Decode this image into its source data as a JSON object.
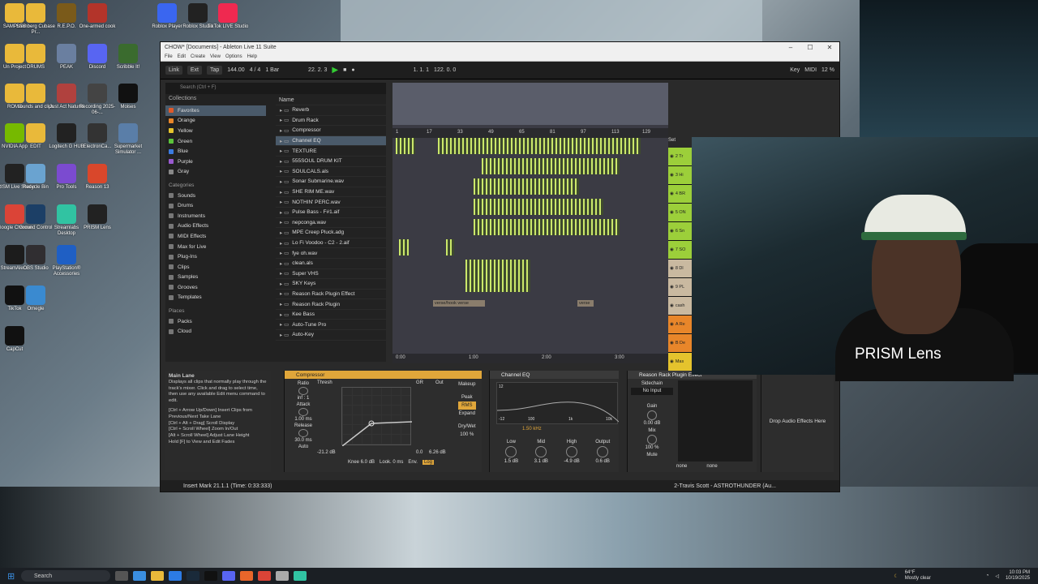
{
  "desktop": {
    "icons_left": [
      {
        "label": "SAMPLES",
        "icon": "folder-icon",
        "color": "#e9b93a"
      },
      {
        "label": "Steinberg Cubase Pr...",
        "icon": "folder-icon",
        "color": "#e9b93a"
      },
      {
        "label": "R.E.P.O.",
        "icon": "game-icon",
        "color": "#7a5a1a"
      },
      {
        "label": "One-armed cook",
        "icon": "game-icon",
        "color": "#b3342a"
      },
      {
        "label": "Un Project",
        "icon": "folder-icon",
        "color": "#e9b93a"
      },
      {
        "label": "DRUMS",
        "icon": "folder-icon",
        "color": "#e9b93a"
      },
      {
        "label": "PEAK",
        "icon": "game-icon",
        "color": "#6a7fa0"
      },
      {
        "label": "Discord",
        "icon": "discord-icon",
        "color": "#5865f2"
      },
      {
        "label": "Scribble It!",
        "icon": "game-icon",
        "color": "#3a6b2e"
      },
      {
        "label": "ROMS",
        "icon": "folder-icon",
        "color": "#e9b93a"
      },
      {
        "label": "sounds and clips",
        "icon": "folder-icon",
        "color": "#e9b93a"
      },
      {
        "label": "Just Act Natural",
        "icon": "game-icon",
        "color": "#b0413e"
      },
      {
        "label": "Recording 2025-06-...",
        "icon": "audio-file-icon",
        "color": "#444"
      },
      {
        "label": "Moises",
        "icon": "app-icon",
        "color": "#111"
      },
      {
        "label": "NVIDIA App",
        "icon": "nvidia-icon",
        "color": "#76b900"
      },
      {
        "label": "EDIT",
        "icon": "folder-icon",
        "color": "#e9b93a"
      },
      {
        "label": "Logitech G HUB",
        "icon": "logitech-icon",
        "color": "#222"
      },
      {
        "label": "ElectronCa...",
        "icon": "app-icon",
        "color": "#333"
      },
      {
        "label": "Supermarket Simulator ...",
        "icon": "game-icon",
        "color": "#5a7ea8"
      },
      {
        "label": "PRISM Live Studio",
        "icon": "prism-icon",
        "color": "#222"
      },
      {
        "label": "Recycle Bin",
        "icon": "recycle-bin-icon",
        "color": "#6aa3d0"
      },
      {
        "label": "Pro Tools",
        "icon": "protools-icon",
        "color": "#7b4bd0"
      },
      {
        "label": "Reason 13",
        "icon": "reason-icon",
        "color": "#d9472b"
      },
      {
        "label": "Google Chrome",
        "icon": "chrome-icon",
        "color": "#db4437"
      },
      {
        "label": "Ground Control",
        "icon": "app-icon",
        "color": "#1c3f66"
      },
      {
        "label": "Streamlabs Desktop",
        "icon": "streamlabs-icon",
        "color": "#31c3a2"
      },
      {
        "label": "PRISM Lens",
        "icon": "prism-icon",
        "color": "#222"
      },
      {
        "label": "StreamAler...",
        "icon": "app-icon",
        "color": "#1c1c1c"
      },
      {
        "label": "OBS Studio",
        "icon": "obs-icon",
        "color": "#302e31"
      },
      {
        "label": "PlayStation® Accessories",
        "icon": "playstation-icon",
        "color": "#1f5fc4"
      },
      {
        "label": "TikTok",
        "icon": "tiktok-icon",
        "color": "#111"
      },
      {
        "label": "Omegle",
        "icon": "app-icon",
        "color": "#3a8ad0"
      },
      {
        "label": "CapCut",
        "icon": "capcut-icon",
        "color": "#111"
      }
    ],
    "icons_top": [
      {
        "label": "Roblox Player",
        "icon": "roblox-icon",
        "color": "#3a66f0"
      },
      {
        "label": "Roblox Studio",
        "icon": "roblox-icon",
        "color": "#222"
      },
      {
        "label": "TikTok LIVE Studio",
        "icon": "tiktok-icon",
        "color": "#ef2950"
      }
    ]
  },
  "window": {
    "title": "CHOW* [Documents] - Ableton Live 11 Suite",
    "menu": [
      "File",
      "Edit",
      "Create",
      "View",
      "Options",
      "Help"
    ],
    "controls": [
      "–",
      "☐",
      "✕"
    ]
  },
  "transport": {
    "link": "Link",
    "ext": "Ext",
    "tap": "Tap",
    "tempo": "144.00",
    "signature": "4 / 4",
    "quantize": "1 Bar",
    "position": "22.  2.  3",
    "loop_start": "1.  1.  1",
    "loop_length": "122.  0.  0",
    "key": "Key",
    "midi": "MIDI",
    "cpu": "12 %"
  },
  "browser": {
    "search_placeholder": "Search (Ctrl + F)",
    "collections_label": "Collections",
    "collections": [
      {
        "label": "Favorites",
        "color": "#e05a2a",
        "selected": true
      },
      {
        "label": "Orange",
        "color": "#e8862a"
      },
      {
        "label": "Yellow",
        "color": "#e5c32d"
      },
      {
        "label": "Green",
        "color": "#5bc43b"
      },
      {
        "label": "Blue",
        "color": "#3b7be0"
      },
      {
        "label": "Purple",
        "color": "#9a5ad0"
      },
      {
        "label": "Gray",
        "color": "#888888"
      }
    ],
    "categories_label": "Categories",
    "categories": [
      "Sounds",
      "Drums",
      "Instruments",
      "Audio Effects",
      "MIDI Effects",
      "Max for Live",
      "Plug-Ins",
      "Clips",
      "Samples",
      "Grooves",
      "Templates"
    ],
    "places_label": "Places",
    "places": [
      "Packs",
      "Cloud"
    ],
    "name_header": "Name",
    "items": [
      "Reverb",
      "Drum Rack",
      "Compressor",
      "Channel EQ",
      "TEXTURE",
      "555SOUL DRUM KIT",
      "SOULCALS.als",
      "Sonar Submarine.wav",
      "SHE RIM ME.wav",
      "NOTHIN' PERC.wav",
      "Pulse Bass - F#1.aif",
      "nepconga.wav",
      "MPE Creep Pluck.adg",
      "Lo Fi Voodoo - C2 - 2.aif",
      "fye oh.wav",
      "clean.als",
      "Super VHS",
      "SKY Keys",
      "Reason Rack Plugin Effect",
      "Reason Rack Plugin",
      "Kee Bass",
      "Auto-Tune Pro",
      "Auto-Key"
    ],
    "selected_item": "Channel EQ"
  },
  "arrangement": {
    "bar_markers": [
      "1",
      "17",
      "33",
      "49",
      "65",
      "81",
      "97",
      "113",
      "129"
    ],
    "time_markers": [
      "0:00",
      "1:00",
      "2:00",
      "3:00"
    ],
    "clip_labels": [
      "verse/hook verse",
      "verse"
    ],
    "set_label": "Set",
    "tracks": [
      {
        "label": "2 Tr",
        "color": "#9ccf3a"
      },
      {
        "label": "3 Hi",
        "color": "#9ccf3a"
      },
      {
        "label": "4 BR",
        "color": "#9ccf3a"
      },
      {
        "label": "5 ON",
        "color": "#9ccf3a"
      },
      {
        "label": "6 Sn",
        "color": "#9ccf3a"
      },
      {
        "label": "7 SO",
        "color": "#9ccf3a"
      },
      {
        "label": "8 Dl",
        "color": "#c9b9a0"
      },
      {
        "label": "9 PL",
        "color": "#c9b9a0"
      },
      {
        "label": "cash",
        "color": "#c9b9a0"
      },
      {
        "label": "A Re",
        "color": "#e8862a"
      },
      {
        "label": "B De",
        "color": "#e8862a"
      },
      {
        "label": "Mas",
        "color": "#e5c32d"
      }
    ]
  },
  "info_panel": {
    "title": "Main Lane",
    "text": "Displays all clips that normally play through the track's mixer. Click and drag to select time, then use any available Edit menu command to edit.",
    "shortcuts": [
      "[Ctrl + Arrow Up/Down] Insert Clips from Previous/Next Take Lane",
      "[Ctrl + Alt + Drag] Scroll Display",
      "[Ctrl + Scroll Wheel] Zoom In/Out",
      "[Alt + Scroll Wheel] Adjust Lane Height",
      "Hold [F] to View and Edit Fades"
    ]
  },
  "compressor": {
    "title": "Compressor",
    "ratio_label": "Ratio",
    "ratio": "inf : 1",
    "attack_label": "Attack",
    "attack": "1.00 ms",
    "release_label": "Release",
    "release": "30.0 ms",
    "auto": "Auto",
    "thresh_label": "Thresh",
    "thresh": "-21.2 dB",
    "gr_label": "GR",
    "out_label": "Out",
    "gr": "0.0",
    "out": "6.26 dB",
    "makeup": "Makeup",
    "peak": "Peak",
    "rms": "RMS",
    "expand": "Expand",
    "drywet_label": "Dry/Wet",
    "drywet": "100 %",
    "knee": "Knee 6.0 dB",
    "look": "Look. 0 ms",
    "env": "Env.",
    "log": "Log"
  },
  "channel_eq": {
    "title": "Channel EQ",
    "freq": "1.50 kHz",
    "db_top": "12",
    "db_bottom": "-12",
    "freq_ticks": [
      "100",
      "1k",
      "10k"
    ],
    "low_label": "Low",
    "mid_label": "Mid",
    "high_label": "High",
    "output_label": "Output",
    "low": "1.5 dB",
    "mid": "3.1 dB",
    "high": "-4.9 dB",
    "output": "0.6 dB"
  },
  "reason_rack": {
    "title": "Reason Rack Plugin Effect",
    "sidechain": "Sidechain",
    "no_input": "No Input",
    "gain_label": "Gain",
    "gain": "0.00 dB",
    "mix_label": "Mix",
    "mix": "100 %",
    "mute": "Mute",
    "none1": "none",
    "none2": "none"
  },
  "drop_zone": "Drop Audio Effects Here",
  "status": {
    "message": "Insert Mark 21.1.1 (Time: 0:33:333)",
    "track": "2-Travis Scott - ASTROTHUNDER (Au..."
  },
  "webcam": {
    "label": "PRISM Lens"
  },
  "taskbar": {
    "search": "Search",
    "weather_temp": "64°F",
    "weather_desc": "Mostly clear",
    "time": "10:03 PM",
    "date": "10/19/2025"
  }
}
